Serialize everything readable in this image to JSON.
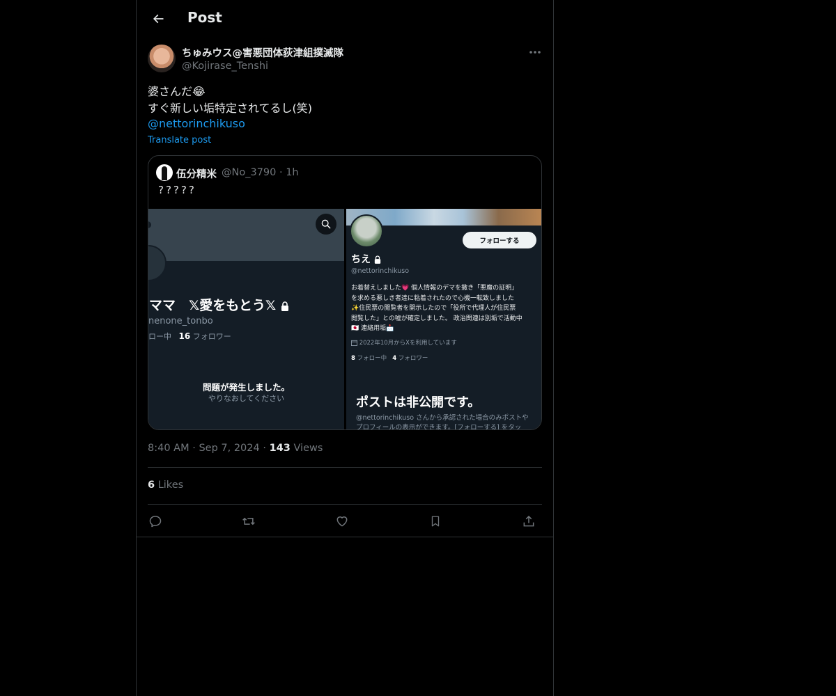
{
  "header": {
    "title": "Post",
    "back_icon": "arrow-left-icon"
  },
  "post": {
    "author_name": "ちゅみウス@害悪団体荻津組撲滅隊",
    "author_handle": "@Kojirase_Tenshi",
    "text_line1": "婆さんだ😂",
    "text_line2": "すぐ新しい垢特定されてるし(笑)",
    "mention": "@nettorinchikuso",
    "translate_label": "Translate post",
    "time": "8:40 AM",
    "date": "Sep 7, 2024",
    "views_count": "143",
    "views_label": "Views",
    "likes_count": "6",
    "likes_label": "Likes"
  },
  "quote": {
    "author_name": "伍分精米",
    "author_handle": "@No_3790",
    "time": "1h",
    "text": "?????",
    "image1": {
      "profile_name": "ママ　𝕏愛をもとう𝕏",
      "handle": "nenone_tonbo",
      "following_label": "ロー中",
      "followers_count": "16",
      "followers_label": "フォロワー",
      "error_title": "問題が発生しました。",
      "error_sub": "やりなおしてください"
    },
    "image2": {
      "follow_button": "フォローする",
      "profile_name": "ちえ",
      "handle": "@nettorinchikuso",
      "bio_lines": [
        "お着替えしました💗 個人情報のデマを撒き「悪魔の証明」",
        "を求める悪しき者達に粘着されたので心機一転致しました",
        "✨住民票の閲覧者を開示したので「役所で代理人が住民票",
        "閲覧した」との嘘が確定しました。 政治関連は別垢で活動中",
        "🇯🇵 連絡用垢📩"
      ],
      "joined": "2022年10月からXを利用しています",
      "following_count": "8",
      "following_label": "フォロー中",
      "followers_count": "4",
      "followers_label": "フォロワー",
      "private_title": "ポストは非公開です。",
      "private_sub_line1": "@nettorinchikuso さんから承認された場合のみポストや",
      "private_sub_line2": "プロフィールの表示ができます。[フォローする] をタッ"
    }
  },
  "actions": [
    "reply-icon",
    "repost-icon",
    "like-icon",
    "bookmark-icon",
    "share-icon"
  ],
  "colors": {
    "background": "#000000",
    "accent": "#1d9bf0",
    "border": "#2f3336",
    "muted": "#71767b"
  }
}
